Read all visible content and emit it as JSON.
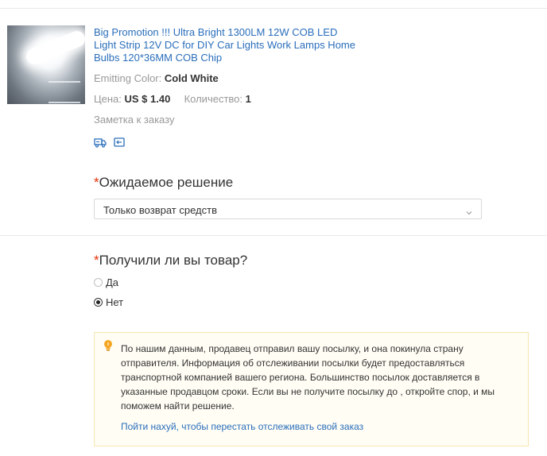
{
  "product": {
    "title": "Big Promotion !!! Ultra Bright 1300LM 12W COB LED Light Strip 12V DC for DIY Car Lights Work Lamps Home Bulbs 120*36MM COB Chip",
    "color_label": "Emitting Color:",
    "color_value": "Cold White",
    "price_label": "Цена:",
    "price_value": "US $ 1.40",
    "qty_label": "Количество:",
    "qty_value": "1",
    "note_link": "Заметка к заказу",
    "icons": [
      "shipping-truck-icon",
      "return-card-icon"
    ]
  },
  "resolution": {
    "required_mark": "*",
    "title": "Ожидаемое решение",
    "selected": "Только возврат средств"
  },
  "received": {
    "required_mark": "*",
    "title": "Получили ли вы товар?",
    "options": [
      {
        "label": "Да",
        "checked": false
      },
      {
        "label": "Нет",
        "checked": true
      }
    ]
  },
  "notice": {
    "icon": "lightbulb-icon",
    "text": "По нашим данным, продавец отправил вашу посылку, и она покинула страну отправителя. Информация об отслеживании посылки будет предоставляться транспортной компанией вашего региона. Большинство посылок доставляется в указанные продавцом сроки. Если вы не получите посылку до , откройте спор, и мы поможем найти решение.",
    "link": "Пойти нахуй, чтобы перестать отслеживать свой заказ"
  },
  "colors": {
    "link": "#2a6ebb",
    "required": "#e62e04",
    "notice_bg": "#fffdf4",
    "notice_border": "#f7e6b0",
    "bulb": "#f5a623"
  }
}
